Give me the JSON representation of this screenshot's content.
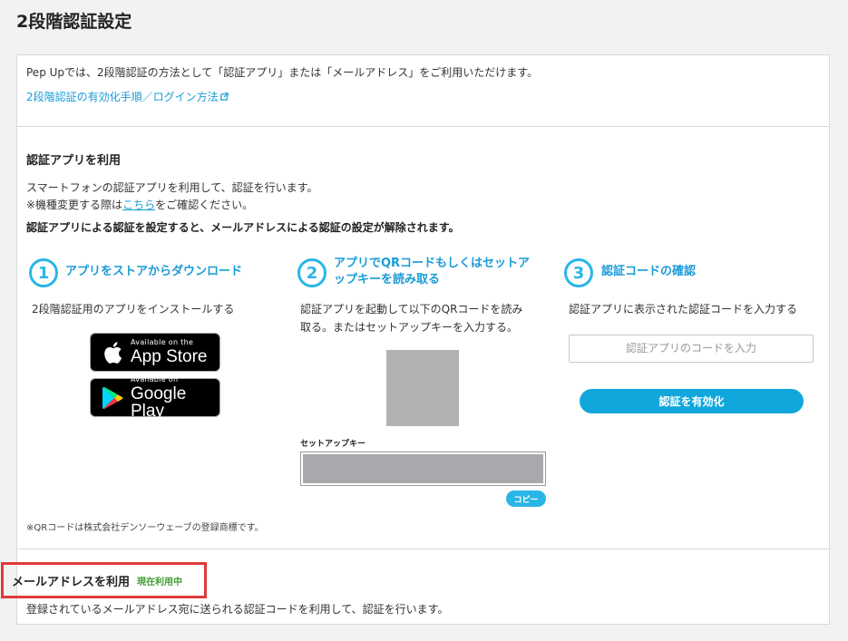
{
  "page_title": "2段階認証設定",
  "intro": {
    "text": "Pep Upでは、2段階認証の方法として「認証アプリ」または「メールアドレス」をご利用いただけます。",
    "link": "2段階認証の有効化手順／ログイン方法"
  },
  "app_section": {
    "title": "認証アプリを利用",
    "line1": "スマートフォンの認証アプリを利用して、認証を行います。",
    "line2_prefix": "※機種変更する際は",
    "line2_link": "こちら",
    "line2_suffix": "をご確認ください。",
    "warning": "認証アプリによる認証を設定すると、メールアドレスによる認証の設定が解除されます。"
  },
  "steps": [
    {
      "num": "1",
      "title": "アプリをストアからダウンロード",
      "desc": "2段階認証用のアプリをインストールする"
    },
    {
      "num": "2",
      "title_line1": "アプリでQRコードもしくはセットア",
      "title_line2": "ップキーを読み取る",
      "desc_line1": "認証アプリを起動して以下のQRコードを読み",
      "desc_line2": "取る。またはセットアップキーを入力する。"
    },
    {
      "num": "3",
      "title": "認証コードの確認",
      "desc": "認証アプリに表示された認証コードを入力する"
    }
  ],
  "badges": {
    "app_store_small": "Available on the",
    "app_store_big": "App Store",
    "google_play_small": "Available on",
    "google_play_big": "Google Play"
  },
  "setup_key": {
    "label": "セットアップキー",
    "copy": "コピー"
  },
  "code_input": {
    "placeholder": "認証アプリのコードを入力"
  },
  "activate_button": "認証を有効化",
  "footnote": "※QRコードは株式会社デンソーウェーブの登録商標です。",
  "email_section": {
    "title": "メールアドレスを利用",
    "status": "現在利用中",
    "desc": "登録されているメールアドレス宛に送られる認証コードを利用して、認証を行います。"
  },
  "colors": {
    "accent": "#29b6e6",
    "highlight_border": "#e03a3a",
    "status_green": "#3d9c2d"
  }
}
